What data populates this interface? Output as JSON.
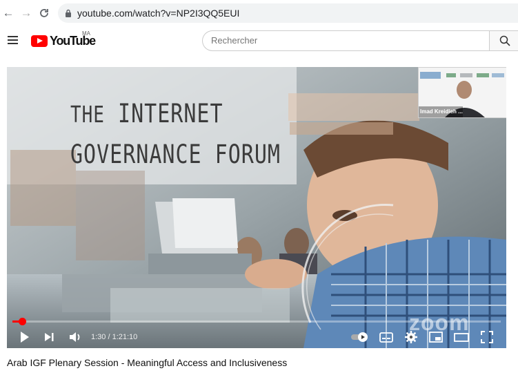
{
  "browser": {
    "url": "youtube.com/watch?v=NP2I3QQ5EUI",
    "icons": [
      "back-icon",
      "forward-icon",
      "reload-icon",
      "lock-icon"
    ]
  },
  "header": {
    "logo_text": "YouTube",
    "region": "MA",
    "search_placeholder": "Rechercher"
  },
  "player": {
    "overlay_line1_prefix": "THE",
    "overlay_line1_rest": "INTERNET",
    "overlay_line2": "GOVERNANCE FORUM",
    "pip_name": "Imad Kreidieh ...",
    "watermark": "zoom",
    "progress_fraction": 0.02,
    "time_display": "1:30 / 1:21:10",
    "accent_color": "#ff0000",
    "control_icons": [
      "play-icon",
      "next-icon",
      "volume-icon",
      "autoplay-toggle-icon",
      "subtitles-icon",
      "settings-icon",
      "miniplayer-icon",
      "theater-icon",
      "fullscreen-icon"
    ]
  },
  "video": {
    "title": "Arab IGF Plenary Session - Meaningful Access and Inclusiveness"
  }
}
